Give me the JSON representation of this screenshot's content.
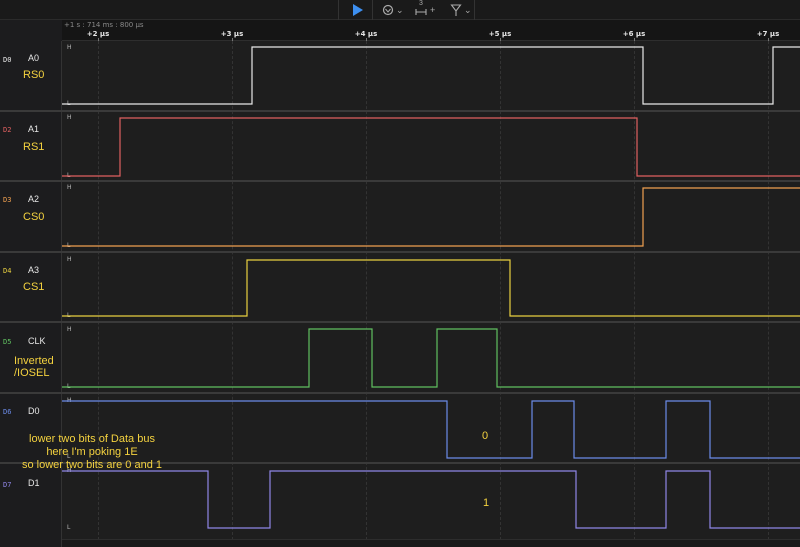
{
  "toolbar": {
    "play_icon": "play-icon",
    "trigger_icon": "trigger-icon",
    "measure_badge": "3",
    "measure_plus": "+",
    "marker_icon": "marker-icon",
    "caret": "⌄"
  },
  "ruler": {
    "origin": "+1 s : 714 ms : 800 µs",
    "ticks": [
      "+2 µs",
      "+3 µs",
      "+4 µs",
      "+5 µs",
      "+6 µs",
      "+7 µs"
    ]
  },
  "channels": [
    {
      "id": "D0",
      "name": "A0",
      "note": "RS0",
      "color": "#e8e8e8"
    },
    {
      "id": "D2",
      "name": "A1",
      "note": "RS1",
      "color": "#e06060"
    },
    {
      "id": "D3",
      "name": "A2",
      "note": "CS0",
      "color": "#f0a050"
    },
    {
      "id": "D4",
      "name": "A3",
      "note": "CS1",
      "color": "#e8d040"
    },
    {
      "id": "D5",
      "name": "CLK",
      "note": "Inverted /IOSEL",
      "color": "#60c060"
    },
    {
      "id": "D6",
      "name": "D0",
      "note": "",
      "color": "#6b8be8"
    },
    {
      "id": "D7",
      "name": "D1",
      "note": "",
      "color": "#8f86e6"
    }
  ],
  "levels": {
    "high": "H",
    "low": "L"
  },
  "annotations": {
    "line1": "lower two bits of Data bus",
    "line2": "here I'm poking 1E",
    "line3": "so lower two bits are 0 and 1",
    "bit0": "0",
    "bit1": "1"
  },
  "signals": [
    {
      "start": 0,
      "transitions": [
        252,
        643,
        773
      ]
    },
    {
      "start": 0,
      "transitions": [
        120,
        637
      ]
    },
    {
      "start": 0,
      "transitions": [
        643
      ]
    },
    {
      "start": 0,
      "transitions": [
        247,
        510
      ]
    },
    {
      "start": 0,
      "transitions": [
        309,
        372,
        437,
        497
      ]
    },
    {
      "start": 1,
      "transitions": [
        447,
        532,
        574,
        666,
        710
      ]
    },
    {
      "start": 1,
      "transitions": [
        208,
        270,
        576,
        666,
        710
      ]
    }
  ]
}
